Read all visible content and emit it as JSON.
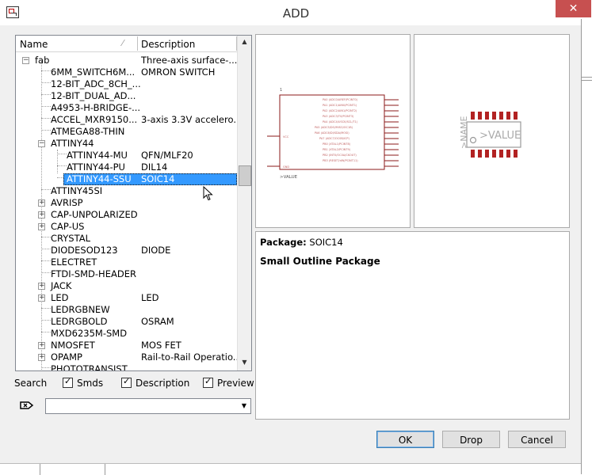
{
  "window": {
    "title": "ADD",
    "close_glyph": "✕"
  },
  "tree": {
    "columns": [
      {
        "label": "Name"
      },
      {
        "label": "Description"
      }
    ],
    "rows": [
      {
        "name": "fab",
        "desc": "Three-axis surface-..."
      },
      {
        "name": "6MM_SWITCH6M...",
        "desc": "OMRON SWITCH"
      },
      {
        "name": "12-BIT_ADC_8CH_...",
        "desc": ""
      },
      {
        "name": "12-BIT_DUAL_AD...",
        "desc": ""
      },
      {
        "name": "A4953-H-BRIDGE-...",
        "desc": ""
      },
      {
        "name": "ACCEL_MXR9150...",
        "desc": "3-axis 3.3V accelero..."
      },
      {
        "name": "ATMEGA88-THIN",
        "desc": ""
      },
      {
        "name": "ATTINY44",
        "desc": ""
      },
      {
        "name": "ATTINY44-MU",
        "desc": "QFN/MLF20"
      },
      {
        "name": "ATTINY44-PU",
        "desc": "DIL14"
      },
      {
        "name": "ATTINY44-SSU",
        "desc": "SOIC14"
      },
      {
        "name": "ATTINY45SI",
        "desc": ""
      },
      {
        "name": "AVRISP",
        "desc": ""
      },
      {
        "name": "CAP-UNPOLARIZED",
        "desc": ""
      },
      {
        "name": "CAP-US",
        "desc": ""
      },
      {
        "name": "CRYSTAL",
        "desc": ""
      },
      {
        "name": "DIODESOD123",
        "desc": "DIODE"
      },
      {
        "name": "ELECTRET",
        "desc": ""
      },
      {
        "name": "FTDI-SMD-HEADER",
        "desc": ""
      },
      {
        "name": "JACK",
        "desc": ""
      },
      {
        "name": "LED",
        "desc": "LED"
      },
      {
        "name": "LEDRGBNEW",
        "desc": ""
      },
      {
        "name": "LEDRGBOLD",
        "desc": "OSRAM"
      },
      {
        "name": "MXD6235M-SMD",
        "desc": ""
      },
      {
        "name": "NMOSFET",
        "desc": "MOS FET"
      },
      {
        "name": "OPAMP",
        "desc": "Rail-to-Rail Operatio..."
      },
      {
        "name": "PHOTOTRANSIST",
        "desc": ""
      }
    ]
  },
  "options": {
    "search_label": "Search",
    "smds_label": "Smds",
    "description_label": "Description",
    "preview_label": "Preview"
  },
  "preview": {
    "symbol": {
      "pin_number": "1",
      "value_label": ">VALUE"
    },
    "package": {
      "name_label": ">NAME",
      "value_label": ">VALUE"
    }
  },
  "details": {
    "package_label": "Package:",
    "package_value": "SOIC14",
    "description": "Small Outline Package"
  },
  "buttons": {
    "ok": "OK",
    "drop": "Drop",
    "cancel": "Cancel"
  },
  "colors": {
    "selection": "#3399ff",
    "close": "#c75050",
    "symbol_line": "#8b1a1a",
    "pad": "#b22222"
  }
}
